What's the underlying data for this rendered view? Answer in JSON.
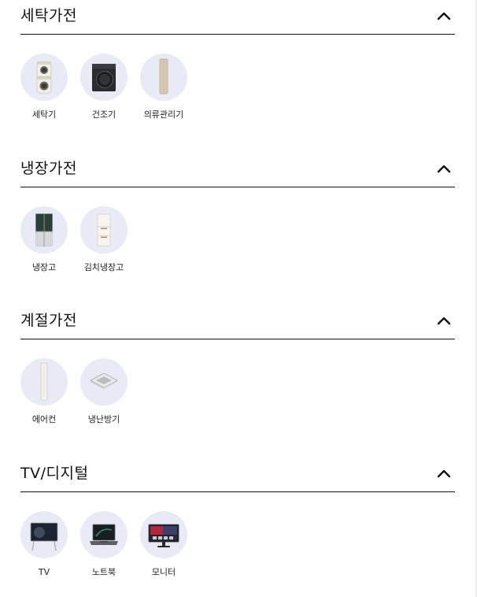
{
  "sections": [
    {
      "title": "세탁가전",
      "chevron_icon": "chevron-up-icon",
      "items": [
        {
          "label": "세탁기",
          "icon": "washer-tower-icon"
        },
        {
          "label": "건조기",
          "icon": "dryer-icon"
        },
        {
          "label": "의류관리기",
          "icon": "clothing-care-icon"
        }
      ]
    },
    {
      "title": "냉장가전",
      "chevron_icon": "chevron-up-icon",
      "items": [
        {
          "label": "냉장고",
          "icon": "refrigerator-icon"
        },
        {
          "label": "김치냉장고",
          "icon": "kimchi-refrigerator-icon"
        }
      ]
    },
    {
      "title": "계절가전",
      "chevron_icon": "chevron-up-icon",
      "items": [
        {
          "label": "에어컨",
          "icon": "air-conditioner-icon"
        },
        {
          "label": "냉난방기",
          "icon": "ceiling-hvac-icon"
        }
      ]
    },
    {
      "title": "TV/디지털",
      "chevron_icon": "chevron-up-icon",
      "items": [
        {
          "label": "TV",
          "icon": "tv-icon"
        },
        {
          "label": "노트북",
          "icon": "laptop-icon"
        },
        {
          "label": "모니터",
          "icon": "monitor-icon"
        }
      ]
    }
  ],
  "colors": {
    "icon_background": "#e8ebf5",
    "divider": "#111111",
    "text": "#111111"
  }
}
